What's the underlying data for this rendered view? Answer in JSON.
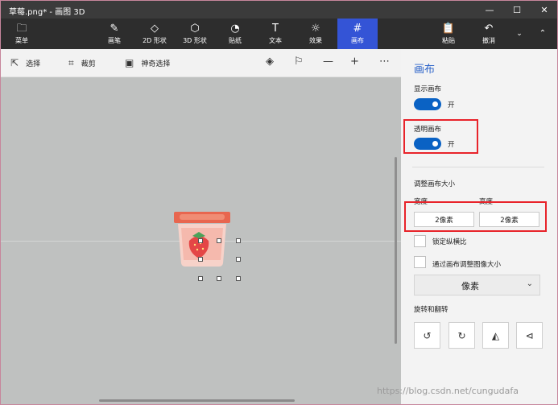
{
  "window": {
    "title": "草莓.png* - 画图 3D",
    "controls": [
      "—",
      "☐",
      "✕"
    ]
  },
  "ribbon": {
    "menu": {
      "label": "菜单",
      "icon": "folder-icon"
    },
    "tools": [
      {
        "label": "画笔",
        "icon": "brush-icon"
      },
      {
        "label": "2D 形状",
        "icon": "shapes-2d-icon"
      },
      {
        "label": "3D 形状",
        "icon": "cube-icon"
      },
      {
        "label": "贴纸",
        "icon": "sticker-icon"
      },
      {
        "label": "文本",
        "icon": "text-icon"
      },
      {
        "label": "效果",
        "icon": "effects-icon"
      },
      {
        "label": "画布",
        "icon": "canvas-icon",
        "active": true
      }
    ],
    "paste": {
      "label": "粘贴",
      "icon": "paste-icon"
    },
    "undo": {
      "label": "撤消",
      "icon": "undo-icon"
    },
    "dropdown_icon": "chevron-down-icon",
    "collapse_icon": "chevron-up-icon"
  },
  "toolbar": {
    "select": {
      "label": "选择",
      "icon": "cursor-icon"
    },
    "crop": {
      "label": "裁剪",
      "icon": "crop-icon"
    },
    "magic_select": {
      "label": "神奇选择",
      "icon": "magic-select-icon"
    },
    "icons": [
      "3d-view-icon",
      "flag-icon",
      "zoom-out-icon",
      "zoom-in-icon",
      "more-icon"
    ]
  },
  "panel": {
    "title": "画布",
    "show_canvas": {
      "label": "显示画布",
      "state": "开",
      "on": true
    },
    "transparent_canvas": {
      "label": "透明画布",
      "state": "开",
      "on": true
    },
    "resize": {
      "heading": "调整画布大小",
      "width_label": "宽度",
      "height_label": "高度",
      "width_value": "2像素",
      "height_value": "2像素"
    },
    "lock_aspect": {
      "label": "锁定纵横比",
      "checked": false
    },
    "resize_image": {
      "label": "通过画布调整图像大小",
      "checked": false
    },
    "unit": {
      "selected": "像素"
    },
    "rotate": {
      "heading": "旋转和翻转",
      "buttons": [
        "rotate-left-icon",
        "rotate-right-icon",
        "flip-horizontal-icon",
        "flip-vertical-icon"
      ]
    }
  },
  "watermark": "https://blog.csdn.net/cungudafa",
  "colors": {
    "accent": "#3454d6",
    "toggle": "#0a62c4",
    "highlight": "#e8232a",
    "canvas_bg": "#bfc1c0"
  }
}
